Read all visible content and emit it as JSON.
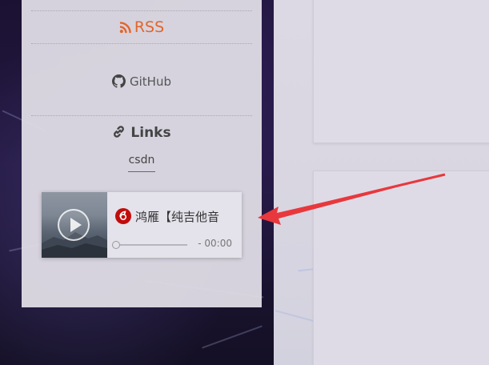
{
  "sidebar": {
    "rss_label": "RSS",
    "github_label": "GitHub",
    "links_title": "Links",
    "links": [
      "csdn"
    ]
  },
  "player": {
    "title": "鸿雁【纯吉他音",
    "time": "- 00:00",
    "progress": 0
  },
  "icons": {
    "rss": "rss-icon",
    "github": "github-icon",
    "links": "link-icon",
    "netease": "netease-music-icon",
    "play": "play-icon"
  },
  "colors": {
    "rss": "#e3652b",
    "netease": "#c20c0c",
    "arrow": "#e8383d",
    "sidebar_bg": "#dedbe4"
  }
}
